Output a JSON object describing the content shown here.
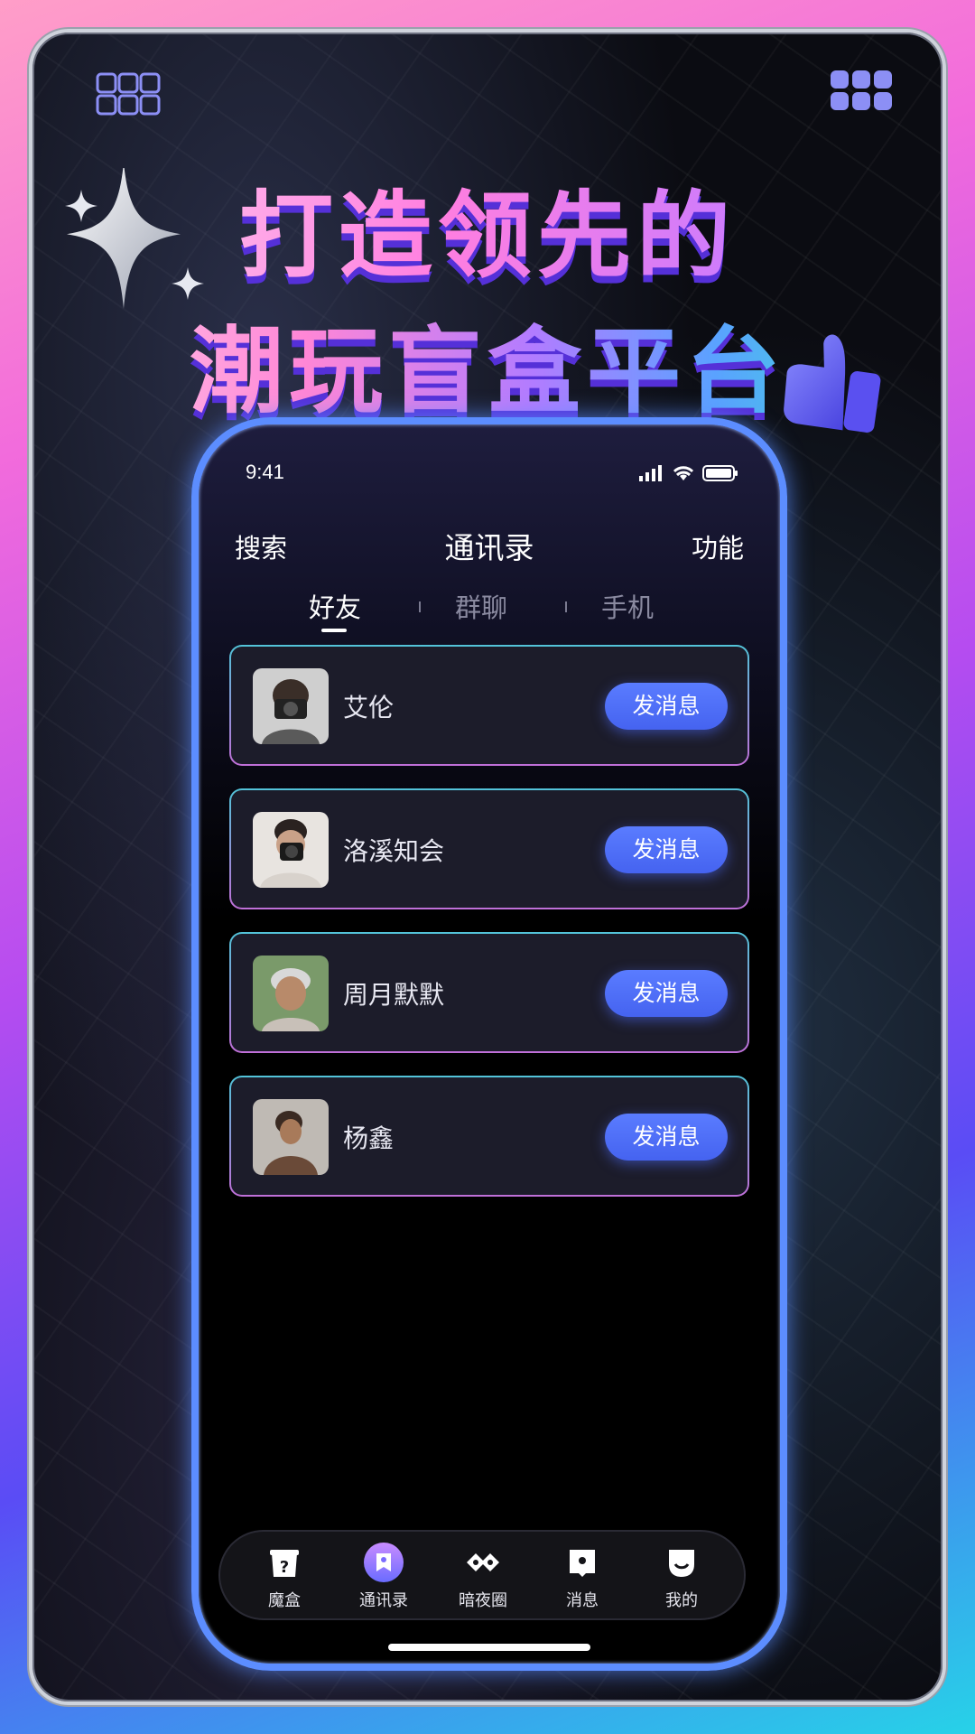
{
  "headline": {
    "line1": "打造领先的",
    "line2": "潮玩盲盒平台"
  },
  "status_bar": {
    "time": "9:41"
  },
  "nav": {
    "left": "搜索",
    "title": "通讯录",
    "right": "功能"
  },
  "tabs": [
    {
      "label": "好友",
      "active": true
    },
    {
      "label": "群聊",
      "active": false
    },
    {
      "label": "手机",
      "active": false
    }
  ],
  "contacts": [
    {
      "name": "艾伦",
      "button": "发消息",
      "avatar": "avatar-photo"
    },
    {
      "name": "洛溪知会",
      "button": "发消息",
      "avatar": "avatar-photo"
    },
    {
      "name": "周月默默",
      "button": "发消息",
      "avatar": "avatar-photo"
    },
    {
      "name": "杨鑫",
      "button": "发消息",
      "avatar": "avatar-photo"
    }
  ],
  "tabbar": [
    {
      "label": "魔盒",
      "icon": "mystery-box-icon",
      "active": false
    },
    {
      "label": "通讯录",
      "icon": "contacts-icon",
      "active": true
    },
    {
      "label": "暗夜圈",
      "icon": "circle-icon",
      "active": false
    },
    {
      "label": "消息",
      "icon": "message-icon",
      "active": false
    },
    {
      "label": "我的",
      "icon": "profile-icon",
      "active": false
    }
  ],
  "colors": {
    "accent": "#4f6cf7",
    "phone_border": "#5c8dff",
    "card_border_top": "#52c3d8",
    "card_border_bottom": "#c06fd8"
  }
}
